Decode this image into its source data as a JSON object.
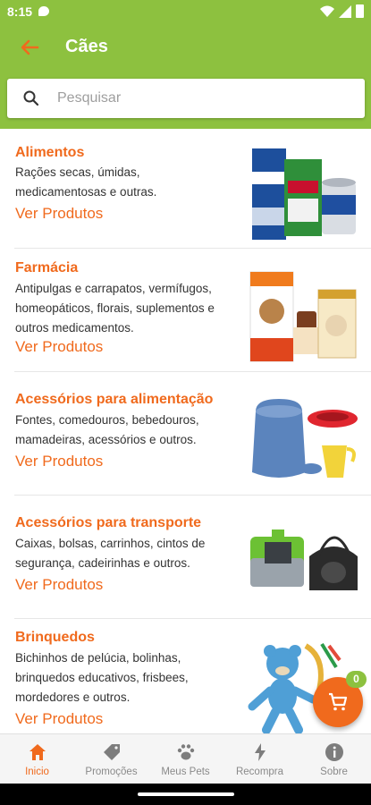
{
  "status_bar": {
    "time": "8:15"
  },
  "app_bar": {
    "title": "Cães"
  },
  "search": {
    "placeholder": "Pesquisar",
    "value": ""
  },
  "categories": [
    {
      "title": "Alimentos",
      "description": "Rações secas, úmidas, medicamentosas e outras.",
      "link": "Ver Produtos"
    },
    {
      "title": "Farmácia",
      "description": "Antipulgas e carrapatos, vermífugos, homeopáticos, florais, suplementos e outros medicamentos.",
      "link": "Ver Produtos"
    },
    {
      "title": "Acessórios para alimentação",
      "description": "Fontes, comedouros, bebedouros, mamadeiras, acessórios e outros.",
      "link": "Ver Produtos"
    },
    {
      "title": "Acessórios para transporte",
      "description": "Caixas, bolsas, carrinhos, cintos de segurança, cadeirinhas e outros.",
      "link": "Ver Produtos"
    },
    {
      "title": "Brinquedos",
      "description": "Bichinhos de pelúcia, bolinhas, brinquedos educativos, frisbees, mordedores e outros.",
      "link": "Ver Produtos"
    }
  ],
  "cart": {
    "count": "0"
  },
  "bottom_nav": [
    {
      "label": "Inicio",
      "icon": "home-icon",
      "active": true
    },
    {
      "label": "Promoções",
      "icon": "tag-icon",
      "active": false
    },
    {
      "label": "Meus Pets",
      "icon": "paw-icon",
      "active": false
    },
    {
      "label": "Recompra",
      "icon": "bolt-icon",
      "active": false
    },
    {
      "label": "Sobre",
      "icon": "info-icon",
      "active": false
    }
  ],
  "colors": {
    "primary_green": "#8dc13f",
    "accent_orange": "#f06a1d"
  }
}
